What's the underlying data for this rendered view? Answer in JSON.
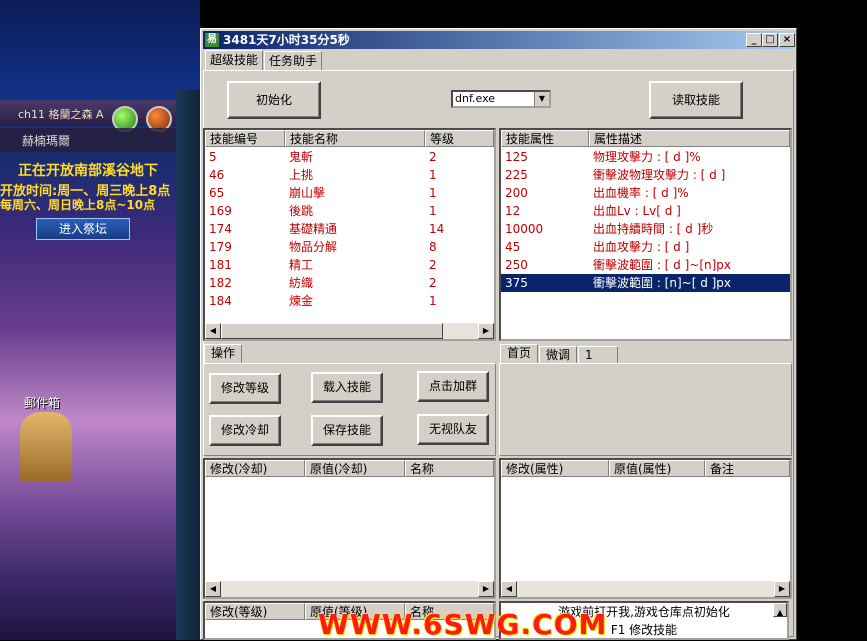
{
  "window": {
    "title": "3481天7小时35分5秒",
    "app_icon": "易",
    "tabs": [
      "超级技能",
      "任务助手"
    ]
  },
  "toolbar": {
    "init_label": "初始化",
    "process_value": "dnf.exe",
    "read_skill_label": "读取技能"
  },
  "skills_table": {
    "headers": [
      "技能编号",
      "技能名称",
      "等级"
    ],
    "rows": [
      {
        "id": "5",
        "name": "鬼斬",
        "level": "2"
      },
      {
        "id": "46",
        "name": "上挑",
        "level": "1"
      },
      {
        "id": "65",
        "name": "崩山擊",
        "level": "1"
      },
      {
        "id": "169",
        "name": "後跳",
        "level": "1"
      },
      {
        "id": "174",
        "name": "基礎精通",
        "level": "14"
      },
      {
        "id": "179",
        "name": "物品分解",
        "level": "8"
      },
      {
        "id": "181",
        "name": "精工",
        "level": "2"
      },
      {
        "id": "182",
        "name": "紡織",
        "level": "2"
      },
      {
        "id": "184",
        "name": "煉金",
        "level": "1"
      }
    ]
  },
  "attr_table": {
    "headers": [
      "技能属性",
      "属性描述"
    ],
    "rows": [
      {
        "val": "125",
        "desc": "物理攻擊力 : [ d ]%"
      },
      {
        "val": "225",
        "desc": "衝擊波物理攻擊力 : [ d ]"
      },
      {
        "val": "200",
        "desc": "出血機率 : [ d ]%"
      },
      {
        "val": "12",
        "desc": "出血Lv : Lv[ d ]"
      },
      {
        "val": "10000",
        "desc": "出血持續時間 : [ d ]秒"
      },
      {
        "val": "45",
        "desc": "出血攻擊力 : [ d ]"
      },
      {
        "val": "250",
        "desc": "衝擊波範圍 : [ d ]~[n]px"
      },
      {
        "val": "375",
        "desc": "衝擊波範圍 : [n]~[ d ]px"
      }
    ]
  },
  "ops": {
    "tab": "操作",
    "buttons": [
      "修改等级",
      "载入技能",
      "点击加群",
      "修改冷却",
      "保存技能",
      "无视队友"
    ]
  },
  "right_tabs": [
    "首页",
    "微调",
    "1"
  ],
  "cooldown_table": {
    "headers": [
      "修改(冷却)",
      "原值(冷却)",
      "名称"
    ]
  },
  "attr_mod_table": {
    "headers": [
      "修改(属性)",
      "原值(属性)",
      "备注"
    ]
  },
  "level_table": {
    "headers": [
      "修改(等级)",
      "原值(等级)",
      "名称"
    ]
  },
  "log": {
    "lines": [
      "游戏前打开我,游戏仓库点初始化",
      "F1 修改技能"
    ]
  },
  "watermark": "WWW.6SWG.COM",
  "game_bg": {
    "channel": "ch11 格蘭之森 A",
    "player": "赫楠瑪爾",
    "notice1": "正在开放南部溪谷地下",
    "notice2": "开放时间:周一、周三晚上8点",
    "notice3": "每周六、周日晚上8点~10点",
    "enter_btn": "进入祭坛",
    "mailbox": "郵件箱"
  },
  "colors": {
    "title_start": "#0a246a",
    "title_end": "#a6caf0",
    "list_text": "#c00000",
    "selection": "#0a246a",
    "watermark": "#ff1a1a"
  }
}
